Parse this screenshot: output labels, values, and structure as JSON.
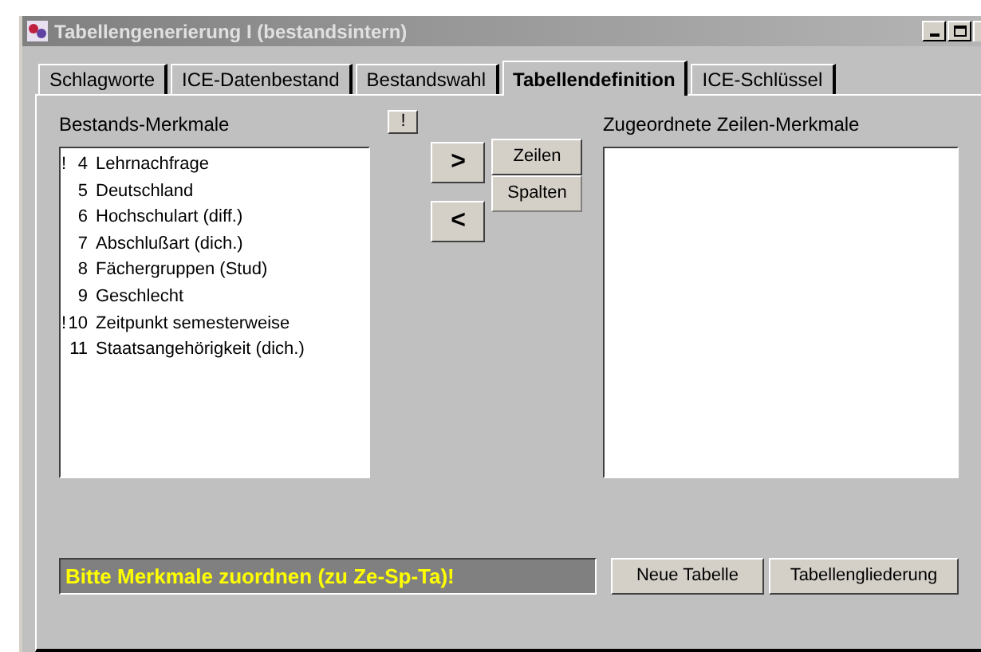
{
  "window": {
    "title": "Tabellengenerierung I (bestandsintern)"
  },
  "tabs": [
    {
      "label": "Schlagworte",
      "selected": false
    },
    {
      "label": "ICE-Datenbestand",
      "selected": false
    },
    {
      "label": "Bestandswahl",
      "selected": false
    },
    {
      "label": "Tabellendefinition",
      "selected": true
    },
    {
      "label": "ICE-Schlüssel",
      "selected": false
    }
  ],
  "source_list": {
    "label": "Bestands-Merkmale",
    "hint_button": "!",
    "items": [
      {
        "flag": "!",
        "number": "4",
        "label": "Lehrnachfrage"
      },
      {
        "number": "5",
        "label": "Deutschland"
      },
      {
        "number": "6",
        "label": "Hochschulart (diff.)"
      },
      {
        "number": "7",
        "label": "Abschlußart (dich.)"
      },
      {
        "number": "8",
        "label": "Fächergruppen (Stud)"
      },
      {
        "number": "9",
        "label": "Geschlecht"
      },
      {
        "flag": "!",
        "number": "10",
        "label": "Zeitpunkt semesterweise"
      },
      {
        "number": "11",
        "label": "Staatsangehörigkeit (dich.)"
      }
    ]
  },
  "move_buttons": [
    ">",
    "<"
  ],
  "target_buttons": [
    {
      "label": "Zeilen",
      "selected": true
    },
    {
      "label": "Spalten",
      "selected": false
    }
  ],
  "target_list": {
    "label": "Zugeordnete Zeilen-Merkmale"
  },
  "status_message": "Bitte Merkmale zuordnen (zu Ze-Sp-Ta)!",
  "buttons": [
    "Neue Tabelle",
    "Tabellengliederung"
  ]
}
